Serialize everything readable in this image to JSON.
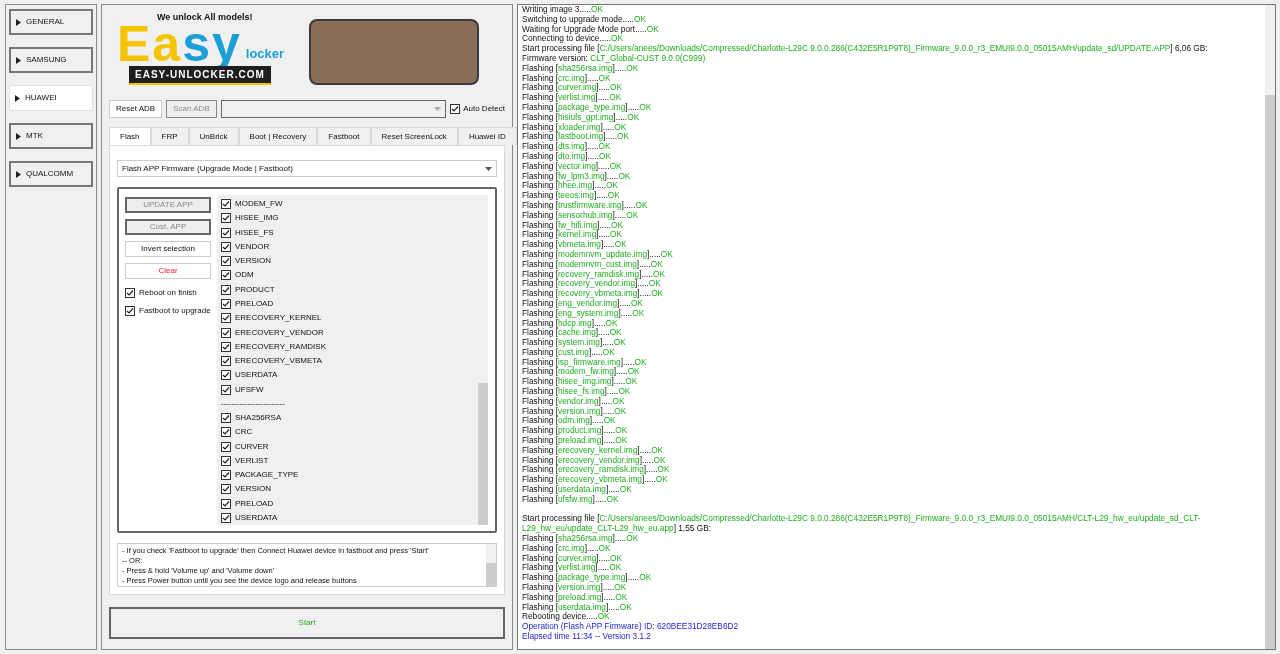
{
  "sidebar": {
    "items": [
      {
        "label": "GENERAL",
        "selected": false
      },
      {
        "label": "SAMSUNG",
        "selected": false
      },
      {
        "label": "HUAWEI",
        "selected": true
      },
      {
        "label": "MTK",
        "selected": false
      },
      {
        "label": "QUALCOMM",
        "selected": false
      }
    ]
  },
  "banner": {
    "tagline": "We unlock All models!",
    "logo": [
      {
        "text": "Ea",
        "color": "#f5c400"
      },
      {
        "text": "sy",
        "color": "#1a9fd6"
      }
    ],
    "logo_sub": "locker",
    "url": "EASY-UNLOCKER.COM"
  },
  "toolbar": {
    "reset_adb": {
      "label": "Reset ADB",
      "disabled": false
    },
    "scan_adb": {
      "label": "Scan ADB",
      "disabled": true
    },
    "auto_detect": {
      "label": "Auto Detect",
      "checked": true
    }
  },
  "tabs": [
    {
      "label": "Flash",
      "selected": true
    },
    {
      "label": "FRP",
      "selected": false
    },
    {
      "label": "UnBrick",
      "selected": false
    },
    {
      "label": "Boot | Recovery",
      "selected": false
    },
    {
      "label": "Fastboot",
      "selected": false
    },
    {
      "label": "Reset ScreenLock",
      "selected": false
    },
    {
      "label": "Huawei ID",
      "selected": false
    }
  ],
  "mode_select": {
    "value": "Flash APP Firmware (Upgrade Mode | Fastboot)"
  },
  "actions": [
    {
      "label": "UPDATE APP",
      "kind": "normal",
      "disabled": true
    },
    {
      "label": "Cust. APP",
      "kind": "normal",
      "disabled": true
    },
    {
      "label": "Invert selection",
      "kind": "normal",
      "disabled": false
    },
    {
      "label": "Clear",
      "kind": "danger",
      "disabled": false
    }
  ],
  "options": [
    {
      "label": "Reboot on finish",
      "checked": true
    },
    {
      "label": "Fastboot to upgrade",
      "checked": true
    }
  ],
  "partitions": [
    {
      "kind": "item",
      "label": "MODEM_FW",
      "checked": true
    },
    {
      "kind": "item",
      "label": "HISEE_IMG",
      "checked": true
    },
    {
      "kind": "item",
      "label": "HISEE_FS",
      "checked": true
    },
    {
      "kind": "item",
      "label": "VENDOR",
      "checked": true
    },
    {
      "kind": "item",
      "label": "VERSION",
      "checked": true
    },
    {
      "kind": "item",
      "label": "ODM",
      "checked": true
    },
    {
      "kind": "item",
      "label": "PRODUCT",
      "checked": true
    },
    {
      "kind": "item",
      "label": "PRELOAD",
      "checked": true
    },
    {
      "kind": "item",
      "label": "ERECOVERY_KERNEL",
      "checked": true
    },
    {
      "kind": "item",
      "label": "ERECOVERY_VENDOR",
      "checked": true
    },
    {
      "kind": "item",
      "label": "ERECOVERY_RAMDISK",
      "checked": true
    },
    {
      "kind": "item",
      "label": "ERECOVERY_VBMETA",
      "checked": true
    },
    {
      "kind": "item",
      "label": "USERDATA",
      "checked": true
    },
    {
      "kind": "item",
      "label": "UFSFW",
      "checked": true
    },
    {
      "kind": "separator",
      "label": "------------------------"
    },
    {
      "kind": "item",
      "label": "SHA256RSA",
      "checked": true
    },
    {
      "kind": "item",
      "label": "CRC",
      "checked": true
    },
    {
      "kind": "item",
      "label": "CURVER",
      "checked": true
    },
    {
      "kind": "item",
      "label": "VERLIST",
      "checked": true
    },
    {
      "kind": "item",
      "label": "PACKAGE_TYPE",
      "checked": true
    },
    {
      "kind": "item",
      "label": "VERSION",
      "checked": true
    },
    {
      "kind": "item",
      "label": "PRELOAD",
      "checked": true
    },
    {
      "kind": "item",
      "label": "USERDATA",
      "checked": true
    }
  ],
  "notes": [
    "- If you check 'Fastboot to upgrade' then Connect Huawei device in fastboot and press 'Start'",
    "-- OR:",
    "- Press & hold 'Volume up' and 'Volume down'",
    "- Press Power button until you see the device logo and release buttons"
  ],
  "start_button": {
    "label": "Start"
  },
  "log": [
    {
      "parts": [
        {
          "text": "Writing image 3.....",
          "kind": "plain"
        },
        {
          "text": "OK",
          "kind": "success"
        }
      ]
    },
    {
      "parts": [
        {
          "text": "Switching to upgrade mode.....",
          "kind": "plain"
        },
        {
          "text": "OK",
          "kind": "success"
        }
      ]
    },
    {
      "parts": [
        {
          "text": "Waiting for Upgrade Mode port.....",
          "kind": "plain"
        },
        {
          "text": "OK",
          "kind": "success"
        }
      ]
    },
    {
      "parts": [
        {
          "text": "Connecting to device.....",
          "kind": "plain"
        },
        {
          "text": "OK",
          "kind": "success"
        }
      ]
    },
    {
      "parts": [
        {
          "text": "Start processing file [",
          "kind": "plain"
        },
        {
          "text": "C:/Users/anees/Downloads/Compressed/Charlotte-L29C 9.0.0.286(C432E5R1P9T8)_Firmware_9.0.0_r3_EMUI9.0.0_05015AMH/update_sd/UPDATE.APP",
          "kind": "success"
        },
        {
          "text": "] 6,06 GB:",
          "kind": "plain"
        }
      ]
    },
    {
      "parts": [
        {
          "text": "Firmware version: ",
          "kind": "plain"
        },
        {
          "text": "CLT_Global-CUST 9.0.0(C999)",
          "kind": "success"
        }
      ]
    },
    {
      "parts": [
        {
          "text": "Flashing [",
          "kind": "plain"
        },
        {
          "text": "sha256rsa.img",
          "kind": "success"
        },
        {
          "text": "].....",
          "kind": "plain"
        },
        {
          "text": "OK",
          "kind": "success"
        }
      ]
    },
    {
      "parts": [
        {
          "text": "Flashing [",
          "kind": "plain"
        },
        {
          "text": "crc.img",
          "kind": "success"
        },
        {
          "text": "].....",
          "kind": "plain"
        },
        {
          "text": "OK",
          "kind": "success"
        }
      ]
    },
    {
      "parts": [
        {
          "text": "Flashing [",
          "kind": "plain"
        },
        {
          "text": "curver.img",
          "kind": "success"
        },
        {
          "text": "].....",
          "kind": "plain"
        },
        {
          "text": "OK",
          "kind": "success"
        }
      ]
    },
    {
      "parts": [
        {
          "text": "Flashing [",
          "kind": "plain"
        },
        {
          "text": "verlist.img",
          "kind": "success"
        },
        {
          "text": "].....",
          "kind": "plain"
        },
        {
          "text": "OK",
          "kind": "success"
        }
      ]
    },
    {
      "parts": [
        {
          "text": "Flashing [",
          "kind": "plain"
        },
        {
          "text": "package_type.img",
          "kind": "success"
        },
        {
          "text": "].....",
          "kind": "plain"
        },
        {
          "text": "OK",
          "kind": "success"
        }
      ]
    },
    {
      "parts": [
        {
          "text": "Flashing [",
          "kind": "plain"
        },
        {
          "text": "hisiufs_gpt.img",
          "kind": "success"
        },
        {
          "text": "].....",
          "kind": "plain"
        },
        {
          "text": "OK",
          "kind": "success"
        }
      ]
    },
    {
      "parts": [
        {
          "text": "Flashing [",
          "kind": "plain"
        },
        {
          "text": "xloader.img",
          "kind": "success"
        },
        {
          "text": "].....",
          "kind": "plain"
        },
        {
          "text": "OK",
          "kind": "success"
        }
      ]
    },
    {
      "parts": [
        {
          "text": "Flashing [",
          "kind": "plain"
        },
        {
          "text": "fastboot.img",
          "kind": "success"
        },
        {
          "text": "].....",
          "kind": "plain"
        },
        {
          "text": "OK",
          "kind": "success"
        }
      ]
    },
    {
      "parts": [
        {
          "text": "Flashing [",
          "kind": "plain"
        },
        {
          "text": "dts.img",
          "kind": "success"
        },
        {
          "text": "].....",
          "kind": "plain"
        },
        {
          "text": "OK",
          "kind": "success"
        }
      ]
    },
    {
      "parts": [
        {
          "text": "Flashing [",
          "kind": "plain"
        },
        {
          "text": "dto.img",
          "kind": "success"
        },
        {
          "text": "].....",
          "kind": "plain"
        },
        {
          "text": "OK",
          "kind": "success"
        }
      ]
    },
    {
      "parts": [
        {
          "text": "Flashing [",
          "kind": "plain"
        },
        {
          "text": "vector.img",
          "kind": "success"
        },
        {
          "text": "].....",
          "kind": "plain"
        },
        {
          "text": "OK",
          "kind": "success"
        }
      ]
    },
    {
      "parts": [
        {
          "text": "Flashing [",
          "kind": "plain"
        },
        {
          "text": "fw_lpm3.img",
          "kind": "success"
        },
        {
          "text": "].....",
          "kind": "plain"
        },
        {
          "text": "OK",
          "kind": "success"
        }
      ]
    },
    {
      "parts": [
        {
          "text": "Flashing [",
          "kind": "plain"
        },
        {
          "text": "hhee.img",
          "kind": "success"
        },
        {
          "text": "].....",
          "kind": "plain"
        },
        {
          "text": "OK",
          "kind": "success"
        }
      ]
    },
    {
      "parts": [
        {
          "text": "Flashing [",
          "kind": "plain"
        },
        {
          "text": "teeos.img",
          "kind": "success"
        },
        {
          "text": "].....",
          "kind": "plain"
        },
        {
          "text": "OK",
          "kind": "success"
        }
      ]
    },
    {
      "parts": [
        {
          "text": "Flashing [",
          "kind": "plain"
        },
        {
          "text": "trustfirmware.img",
          "kind": "success"
        },
        {
          "text": "].....",
          "kind": "plain"
        },
        {
          "text": "OK",
          "kind": "success"
        }
      ]
    },
    {
      "parts": [
        {
          "text": "Flashing [",
          "kind": "plain"
        },
        {
          "text": "sensorhub.img",
          "kind": "success"
        },
        {
          "text": "].....",
          "kind": "plain"
        },
        {
          "text": "OK",
          "kind": "success"
        }
      ]
    },
    {
      "parts": [
        {
          "text": "Flashing [",
          "kind": "plain"
        },
        {
          "text": "fw_hifi.img",
          "kind": "success"
        },
        {
          "text": "].....",
          "kind": "plain"
        },
        {
          "text": "OK",
          "kind": "success"
        }
      ]
    },
    {
      "parts": [
        {
          "text": "Flashing [",
          "kind": "plain"
        },
        {
          "text": "kernel.img",
          "kind": "success"
        },
        {
          "text": "].....",
          "kind": "plain"
        },
        {
          "text": "OK",
          "kind": "success"
        }
      ]
    },
    {
      "parts": [
        {
          "text": "Flashing [",
          "kind": "plain"
        },
        {
          "text": "vbmeta.img",
          "kind": "success"
        },
        {
          "text": "].....",
          "kind": "plain"
        },
        {
          "text": "OK",
          "kind": "success"
        }
      ]
    },
    {
      "parts": [
        {
          "text": "Flashing [",
          "kind": "plain"
        },
        {
          "text": "modemnvm_update.img",
          "kind": "success"
        },
        {
          "text": "].....",
          "kind": "plain"
        },
        {
          "text": "OK",
          "kind": "success"
        }
      ]
    },
    {
      "parts": [
        {
          "text": "Flashing [",
          "kind": "plain"
        },
        {
          "text": "modemnvm_cust.img",
          "kind": "success"
        },
        {
          "text": "].....",
          "kind": "plain"
        },
        {
          "text": "OK",
          "kind": "success"
        }
      ]
    },
    {
      "parts": [
        {
          "text": "Flashing [",
          "kind": "plain"
        },
        {
          "text": "recovery_ramdisk.img",
          "kind": "success"
        },
        {
          "text": "].....",
          "kind": "plain"
        },
        {
          "text": "OK",
          "kind": "success"
        }
      ]
    },
    {
      "parts": [
        {
          "text": "Flashing [",
          "kind": "plain"
        },
        {
          "text": "recovery_vendor.img",
          "kind": "success"
        },
        {
          "text": "].....",
          "kind": "plain"
        },
        {
          "text": "OK",
          "kind": "success"
        }
      ]
    },
    {
      "parts": [
        {
          "text": "Flashing [",
          "kind": "plain"
        },
        {
          "text": "recovery_vbmeta.img",
          "kind": "success"
        },
        {
          "text": "].....",
          "kind": "plain"
        },
        {
          "text": "OK",
          "kind": "success"
        }
      ]
    },
    {
      "parts": [
        {
          "text": "Flashing [",
          "kind": "plain"
        },
        {
          "text": "eng_vendor.img",
          "kind": "success"
        },
        {
          "text": "].....",
          "kind": "plain"
        },
        {
          "text": "OK",
          "kind": "success"
        }
      ]
    },
    {
      "parts": [
        {
          "text": "Flashing [",
          "kind": "plain"
        },
        {
          "text": "eng_system.img",
          "kind": "success"
        },
        {
          "text": "].....",
          "kind": "plain"
        },
        {
          "text": "OK",
          "kind": "success"
        }
      ]
    },
    {
      "parts": [
        {
          "text": "Flashing [",
          "kind": "plain"
        },
        {
          "text": "hdcp.img",
          "kind": "success"
        },
        {
          "text": "].....",
          "kind": "plain"
        },
        {
          "text": "OK",
          "kind": "success"
        }
      ]
    },
    {
      "parts": [
        {
          "text": "Flashing [",
          "kind": "plain"
        },
        {
          "text": "cache.img",
          "kind": "success"
        },
        {
          "text": "].....",
          "kind": "plain"
        },
        {
          "text": "OK",
          "kind": "success"
        }
      ]
    },
    {
      "parts": [
        {
          "text": "Flashing [",
          "kind": "plain"
        },
        {
          "text": "system.img",
          "kind": "success"
        },
        {
          "text": "].....",
          "kind": "plain"
        },
        {
          "text": "OK",
          "kind": "success"
        }
      ]
    },
    {
      "parts": [
        {
          "text": "Flashing [",
          "kind": "plain"
        },
        {
          "text": "cust.img",
          "kind": "success"
        },
        {
          "text": "].....",
          "kind": "plain"
        },
        {
          "text": "OK",
          "kind": "success"
        }
      ]
    },
    {
      "parts": [
        {
          "text": "Flashing [",
          "kind": "plain"
        },
        {
          "text": "isp_firmware.img",
          "kind": "success"
        },
        {
          "text": "].....",
          "kind": "plain"
        },
        {
          "text": "OK",
          "kind": "success"
        }
      ]
    },
    {
      "parts": [
        {
          "text": "Flashing [",
          "kind": "plain"
        },
        {
          "text": "modem_fw.img",
          "kind": "success"
        },
        {
          "text": "].....",
          "kind": "plain"
        },
        {
          "text": "OK",
          "kind": "success"
        }
      ]
    },
    {
      "parts": [
        {
          "text": "Flashing [",
          "kind": "plain"
        },
        {
          "text": "hisee_img.img",
          "kind": "success"
        },
        {
          "text": "].....",
          "kind": "plain"
        },
        {
          "text": "OK",
          "kind": "success"
        }
      ]
    },
    {
      "parts": [
        {
          "text": "Flashing [",
          "kind": "plain"
        },
        {
          "text": "hisee_fs.img",
          "kind": "success"
        },
        {
          "text": "].....",
          "kind": "plain"
        },
        {
          "text": "OK",
          "kind": "success"
        }
      ]
    },
    {
      "parts": [
        {
          "text": "Flashing [",
          "kind": "plain"
        },
        {
          "text": "vendor.img",
          "kind": "success"
        },
        {
          "text": "].....",
          "kind": "plain"
        },
        {
          "text": "OK",
          "kind": "success"
        }
      ]
    },
    {
      "parts": [
        {
          "text": "Flashing [",
          "kind": "plain"
        },
        {
          "text": "version.img",
          "kind": "success"
        },
        {
          "text": "].....",
          "kind": "plain"
        },
        {
          "text": "OK",
          "kind": "success"
        }
      ]
    },
    {
      "parts": [
        {
          "text": "Flashing [",
          "kind": "plain"
        },
        {
          "text": "odm.img",
          "kind": "success"
        },
        {
          "text": "].....",
          "kind": "plain"
        },
        {
          "text": "OK",
          "kind": "success"
        }
      ]
    },
    {
      "parts": [
        {
          "text": "Flashing [",
          "kind": "plain"
        },
        {
          "text": "product.img",
          "kind": "success"
        },
        {
          "text": "].....",
          "kind": "plain"
        },
        {
          "text": "OK",
          "kind": "success"
        }
      ]
    },
    {
      "parts": [
        {
          "text": "Flashing [",
          "kind": "plain"
        },
        {
          "text": "preload.img",
          "kind": "success"
        },
        {
          "text": "].....",
          "kind": "plain"
        },
        {
          "text": "OK",
          "kind": "success"
        }
      ]
    },
    {
      "parts": [
        {
          "text": "Flashing [",
          "kind": "plain"
        },
        {
          "text": "erecovery_kernel.img",
          "kind": "success"
        },
        {
          "text": "].....",
          "kind": "plain"
        },
        {
          "text": "OK",
          "kind": "success"
        }
      ]
    },
    {
      "parts": [
        {
          "text": "Flashing [",
          "kind": "plain"
        },
        {
          "text": "erecovery_vendor.img",
          "kind": "success"
        },
        {
          "text": "].....",
          "kind": "plain"
        },
        {
          "text": "OK",
          "kind": "success"
        }
      ]
    },
    {
      "parts": [
        {
          "text": "Flashing [",
          "kind": "plain"
        },
        {
          "text": "erecovery_ramdisk.img",
          "kind": "success"
        },
        {
          "text": "].....",
          "kind": "plain"
        },
        {
          "text": "OK",
          "kind": "success"
        }
      ]
    },
    {
      "parts": [
        {
          "text": "Flashing [",
          "kind": "plain"
        },
        {
          "text": "erecovery_vbmeta.img",
          "kind": "success"
        },
        {
          "text": "].....",
          "kind": "plain"
        },
        {
          "text": "OK",
          "kind": "success"
        }
      ]
    },
    {
      "parts": [
        {
          "text": "Flashing [",
          "kind": "plain"
        },
        {
          "text": "userdata.img",
          "kind": "success"
        },
        {
          "text": "].....",
          "kind": "plain"
        },
        {
          "text": "OK",
          "kind": "success"
        }
      ]
    },
    {
      "parts": [
        {
          "text": "Flashing [",
          "kind": "plain"
        },
        {
          "text": "ufsfw.img",
          "kind": "success"
        },
        {
          "text": "].....",
          "kind": "plain"
        },
        {
          "text": "OK",
          "kind": "success"
        }
      ]
    },
    {
      "gap_before": true,
      "parts": [
        {
          "text": "Start processing file [",
          "kind": "plain"
        },
        {
          "text": "C:/Users/anees/Downloads/Compressed/Charlotte-L29C 9.0.0.286(C432E5R1P9T8)_Firmware_9.0.0_r3_EMUI9.0.0_05015AMH/CLT-L29_hw_eu/update_sd_CLT-L29_hw_eu/update_CLT-L29_hw_eu.app",
          "kind": "success"
        },
        {
          "text": "] 1,55 GB:",
          "kind": "plain"
        }
      ]
    },
    {
      "parts": [
        {
          "text": "Flashing [",
          "kind": "plain"
        },
        {
          "text": "sha256rsa.img",
          "kind": "success"
        },
        {
          "text": "].....",
          "kind": "plain"
        },
        {
          "text": "OK",
          "kind": "success"
        }
      ]
    },
    {
      "parts": [
        {
          "text": "Flashing [",
          "kind": "plain"
        },
        {
          "text": "crc.img",
          "kind": "success"
        },
        {
          "text": "].....",
          "kind": "plain"
        },
        {
          "text": "OK",
          "kind": "success"
        }
      ]
    },
    {
      "parts": [
        {
          "text": "Flashing [",
          "kind": "plain"
        },
        {
          "text": "curver.img",
          "kind": "success"
        },
        {
          "text": "].....",
          "kind": "plain"
        },
        {
          "text": "OK",
          "kind": "success"
        }
      ]
    },
    {
      "parts": [
        {
          "text": "Flashing [",
          "kind": "plain"
        },
        {
          "text": "verlist.img",
          "kind": "success"
        },
        {
          "text": "].....",
          "kind": "plain"
        },
        {
          "text": "OK",
          "kind": "success"
        }
      ]
    },
    {
      "parts": [
        {
          "text": "Flashing [",
          "kind": "plain"
        },
        {
          "text": "package_type.img",
          "kind": "success"
        },
        {
          "text": "].....",
          "kind": "plain"
        },
        {
          "text": "OK",
          "kind": "success"
        }
      ]
    },
    {
      "parts": [
        {
          "text": "Flashing [",
          "kind": "plain"
        },
        {
          "text": "version.img",
          "kind": "success"
        },
        {
          "text": "].....",
          "kind": "plain"
        },
        {
          "text": "OK",
          "kind": "success"
        }
      ]
    },
    {
      "parts": [
        {
          "text": "Flashing [",
          "kind": "plain"
        },
        {
          "text": "preload.img",
          "kind": "success"
        },
        {
          "text": "].....",
          "kind": "plain"
        },
        {
          "text": "OK",
          "kind": "success"
        }
      ]
    },
    {
      "parts": [
        {
          "text": "Flashing [",
          "kind": "plain"
        },
        {
          "text": "userdata.img",
          "kind": "success"
        },
        {
          "text": "].....",
          "kind": "plain"
        },
        {
          "text": "OK",
          "kind": "success"
        }
      ]
    },
    {
      "parts": [
        {
          "text": "Rebooting device.....",
          "kind": "plain"
        },
        {
          "text": "OK",
          "kind": "success"
        }
      ]
    },
    {
      "parts": [
        {
          "text": "Operation (Flash APP Firmware) ID: 620BEE31D28EB6D2",
          "kind": "info"
        }
      ]
    },
    {
      "parts": [
        {
          "text": "Elapsed time 11:34 -- Version 3.1.2",
          "kind": "info"
        }
      ]
    }
  ]
}
